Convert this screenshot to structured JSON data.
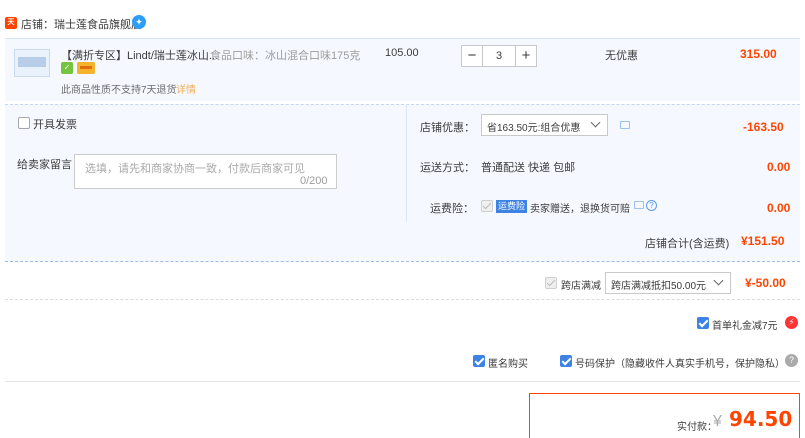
{
  "shop": {
    "badge": "天猫",
    "name": "店铺：瑞士莲食品旗舰店",
    "ww_icon": "wangwang-chat-icon"
  },
  "item": {
    "title": "【满折专区】Lindt/瑞士莲冰山...",
    "attr": "食品口味：冰山混合口味175克",
    "note": "此商品性质不支持7天退货",
    "note_link": "详情",
    "unit_price": "105.00",
    "quantity": "3",
    "minus": "−",
    "plus": "+",
    "promo": "无优惠",
    "subtotal": "315.00"
  },
  "options": {
    "invoice_label": "开具发票",
    "message_label": "给卖家留言：",
    "message_placeholder": "选填，请先和商家协商一致，付款后商家可见",
    "message_count": "0/200",
    "shop_discount_label": "店铺优惠：",
    "shop_discount_select": "省163.50元:组合优惠",
    "shop_discount_value": "-163.50",
    "ship_label": "运送方式：",
    "ship_method": "普通配送 快递 包邮",
    "ship_value": "0.00",
    "insurance_label": "运费险：",
    "insurance_tag": "运费险",
    "insurance_desc": "卖家赠送，退换货可赔",
    "insurance_value": "0.00",
    "total_label": "店铺合计(含运费)",
    "total_value": "¥151.50"
  },
  "cross_shop": {
    "label": "跨店满减",
    "select": "跨店满减抵扣50.00元",
    "value": "¥-50.00"
  },
  "first_order": {
    "label": "首单礼金减7元"
  },
  "privacy": {
    "anonymous_label": "匿名购买",
    "phone_label": "号码保护（隐藏收件人真实手机号，保护隐私）"
  },
  "payment": {
    "label": "实付款：",
    "currency": "¥",
    "amount": "94.50"
  },
  "colors": {
    "accent": "#ff4400",
    "blue": "#3d83e4",
    "panel": "#f5f9ff"
  }
}
